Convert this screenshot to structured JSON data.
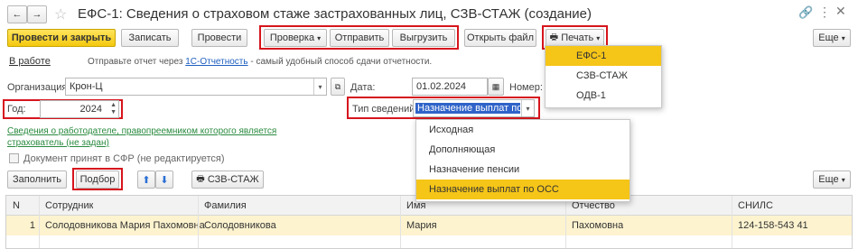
{
  "window": {
    "title": "ЕФС-1: Сведения о страховом стаже застрахованных лиц, СЗВ-СТАЖ (создание)"
  },
  "toolbar": {
    "post_close": "Провести и закрыть",
    "save": "Записать",
    "post": "Провести",
    "check": "Проверка",
    "send": "Отправить",
    "upload": "Выгрузить",
    "open_file": "Открыть файл",
    "print": "Печать",
    "more": "Еще"
  },
  "status": {
    "state": "В работе",
    "hint_before": "Отправьте отчет через",
    "hint_link": "1С-Отчетность",
    "hint_after": "- самый удобный способ сдачи отчетности."
  },
  "form": {
    "org_label": "Организация:",
    "org_value": "Крон-Ц",
    "date_label": "Дата:",
    "date_value": "01.02.2024",
    "number_label": "Номер:",
    "year_label": "Год:",
    "year_value": "2024",
    "info_type_label": "Тип сведений:",
    "info_type_value": "Назначение выплат по ОСС",
    "successor_link": "Сведения о работодателе, правопреемником которого является страхователь (не задан)",
    "accepted_label": "Документ принят в СФР (не редактируется)"
  },
  "print_menu": [
    "ЕФС-1",
    "СЗВ-СТАЖ",
    "ОДВ-1"
  ],
  "info_type_menu": [
    "Исходная",
    "Дополняющая",
    "Назначение пенсии",
    "Назначение выплат по ОСС"
  ],
  "table_toolbar": {
    "fill": "Заполнить",
    "pick": "Подбор",
    "szv": "СЗВ-СТАЖ",
    "more": "Еще"
  },
  "table": {
    "headers": [
      "N",
      "Сотрудник",
      "Фамилия",
      "Имя",
      "Отчество",
      "СНИЛС"
    ],
    "rows": [
      [
        "1",
        "Солодовникова Мария Пахомовна",
        "Солодовникова",
        "Мария",
        "Пахомовна",
        "124-158-543 41"
      ]
    ]
  },
  "colors": {
    "accent_yellow": "#f5c518",
    "highlight_red": "#d6151d",
    "link_green": "#2a8a3f",
    "row_highlight": "#fdf3cf"
  }
}
